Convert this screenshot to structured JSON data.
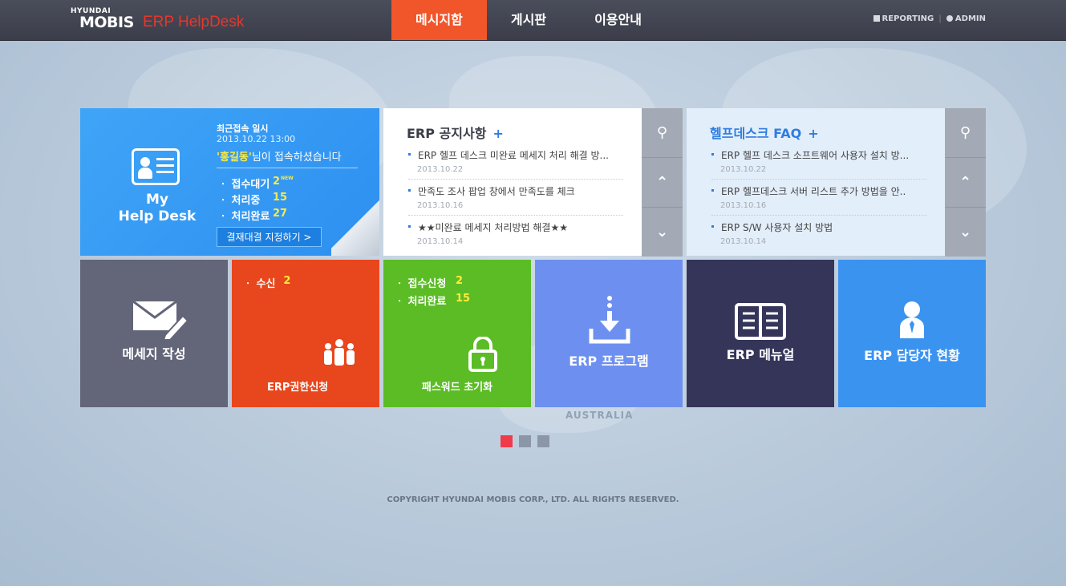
{
  "header": {
    "logo_small": "HYUNDAI",
    "logo_big": "MOBIS",
    "logo_product": "ERP HelpDesk",
    "nav": [
      "메시지함",
      "게시판",
      "이용안내"
    ],
    "util": [
      "REPORTING",
      "ADMIN"
    ]
  },
  "myhelpdesk": {
    "title_line1": "My",
    "title_line2": "Help Desk",
    "recent_label": "최근접속 일시",
    "recent_date": "2013.10.22 13:00",
    "user_name": "'홍길동'",
    "user_suffix": "님이 접속하셨습니다",
    "stats": [
      {
        "label": "ㆍ 접수대기",
        "value": "2",
        "badge": "NEW"
      },
      {
        "label": "ㆍ 처리중",
        "value": "15"
      },
      {
        "label": "ㆍ 처리완료",
        "value": "27"
      }
    ],
    "button": "결재대결 지정하기 >"
  },
  "notice": {
    "title": "ERP 공지사항",
    "plus": "+",
    "items": [
      {
        "title": "ERP 헬프 데스크 미완료 메세지 처리 해결 방...",
        "date": "2013.10.22"
      },
      {
        "title": "만족도 조사 팝업 창에서 만족도를 체크",
        "date": "2013.10.16"
      },
      {
        "title": "★★미완료 메세지 처리방법 해결★★",
        "date": "2013.10.14"
      }
    ]
  },
  "faq": {
    "title": "헬프데스크 FAQ",
    "plus": "+",
    "items": [
      {
        "title": "ERP 헬프 데스크 소프트웨어 사용자 설치 방...",
        "date": "2013.10.22"
      },
      {
        "title": "ERP 헬프데스크 서버 리스트 추가 방법을 안..",
        "date": "2013.10.16"
      },
      {
        "title": "ERP S/W 사용자 설치 방법",
        "date": "2013.10.14"
      }
    ]
  },
  "tiles": {
    "compose": "메세지 작성",
    "authority": {
      "label": "ERP권한신청",
      "stat_label": "ㆍ 수신",
      "stat_value": "2"
    },
    "password": {
      "label": "패스워드 초기화",
      "stats": [
        {
          "label": "ㆍ 접수신청",
          "value": "2"
        },
        {
          "label": "ㆍ 처리완료",
          "value": "15"
        }
      ]
    },
    "program": "ERP 프로그램",
    "manual": "ERP 메뉴얼",
    "manager": "ERP 담당자 현황"
  },
  "map_label": "AUSTRALIA",
  "copyright": "COPYRIGHT HYUNDAI MOBIS CORP., LTD. ALL RIGHTS RESERVED.",
  "colors": {
    "accent": "#f0562a",
    "red_dot": "#f03a4a"
  }
}
